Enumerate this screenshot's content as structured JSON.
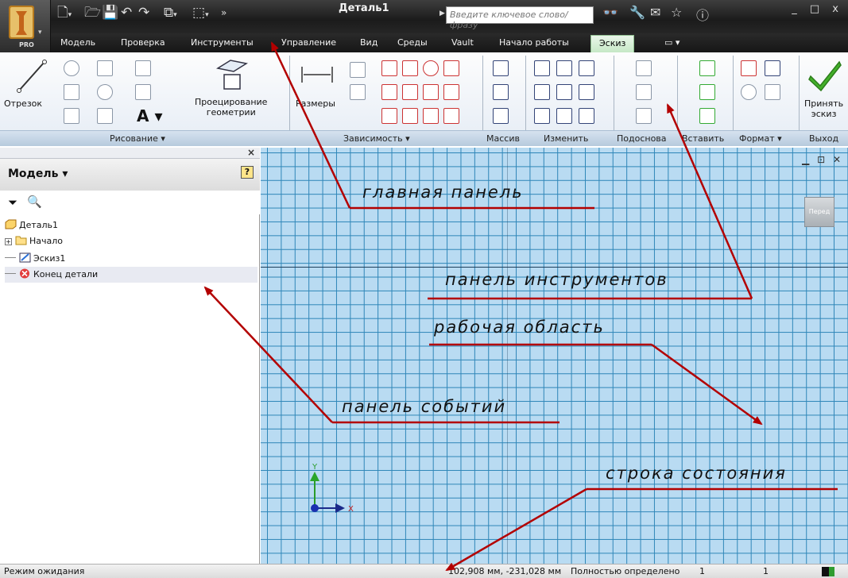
{
  "window": {
    "document_title": "Деталь1",
    "search_placeholder": "Введите ключевое слово/фразу",
    "edition": "PRO",
    "controls": "_ □ x"
  },
  "tabs": [
    {
      "label": "Модель"
    },
    {
      "label": "Проверка"
    },
    {
      "label": "Инструменты"
    },
    {
      "label": "Управление"
    },
    {
      "label": "Вид"
    },
    {
      "label": "Среды"
    },
    {
      "label": "Vault"
    },
    {
      "label": "Начало работы"
    },
    {
      "label": "Эскиз",
      "active": true
    }
  ],
  "ribbon": {
    "line_tool": "Отрезок",
    "project_geometry": [
      "Проецирование",
      "геометрии"
    ],
    "dimensions": "Размеры",
    "accept_sketch": [
      "Принять",
      "эскиз"
    ],
    "panels": {
      "draw": "Рисование ▾",
      "constraints": "Зависимость ▾",
      "pattern": "Массив",
      "modify": "Изменить",
      "layout": "Подоснова",
      "insert": "Вставить",
      "format": "Формат ▾",
      "exit": "Выход"
    }
  },
  "browser": {
    "title": "Модель ▾",
    "tree": [
      {
        "label": "Деталь1",
        "icon": "part-icon"
      },
      {
        "label": "Начало",
        "icon": "folder-icon"
      },
      {
        "label": "Эскиз1",
        "icon": "sketch-icon"
      },
      {
        "label": "Конец детали",
        "icon": "end-of-part-icon"
      }
    ]
  },
  "workspace": {
    "view_cube_label": "Перед",
    "axis_y": "Y",
    "axis_x": "X"
  },
  "status": {
    "mode": "Режим ожидания",
    "coords": "102,908 мм, -231,028 мм",
    "state": "Полностью определено",
    "n1": "1",
    "n2": "1"
  },
  "annotations": {
    "main_panel": "главная панель",
    "toolbar": "панель инструментов",
    "workspace": "рабочая область",
    "event_panel": "панель событий",
    "status_line": "строка состояния"
  },
  "colors": {
    "annotation_arrow": "#b30000",
    "grid_line": "#2e86b8",
    "grid_bg": "#b9dbf2",
    "active_tab": "#c6e8c6"
  }
}
